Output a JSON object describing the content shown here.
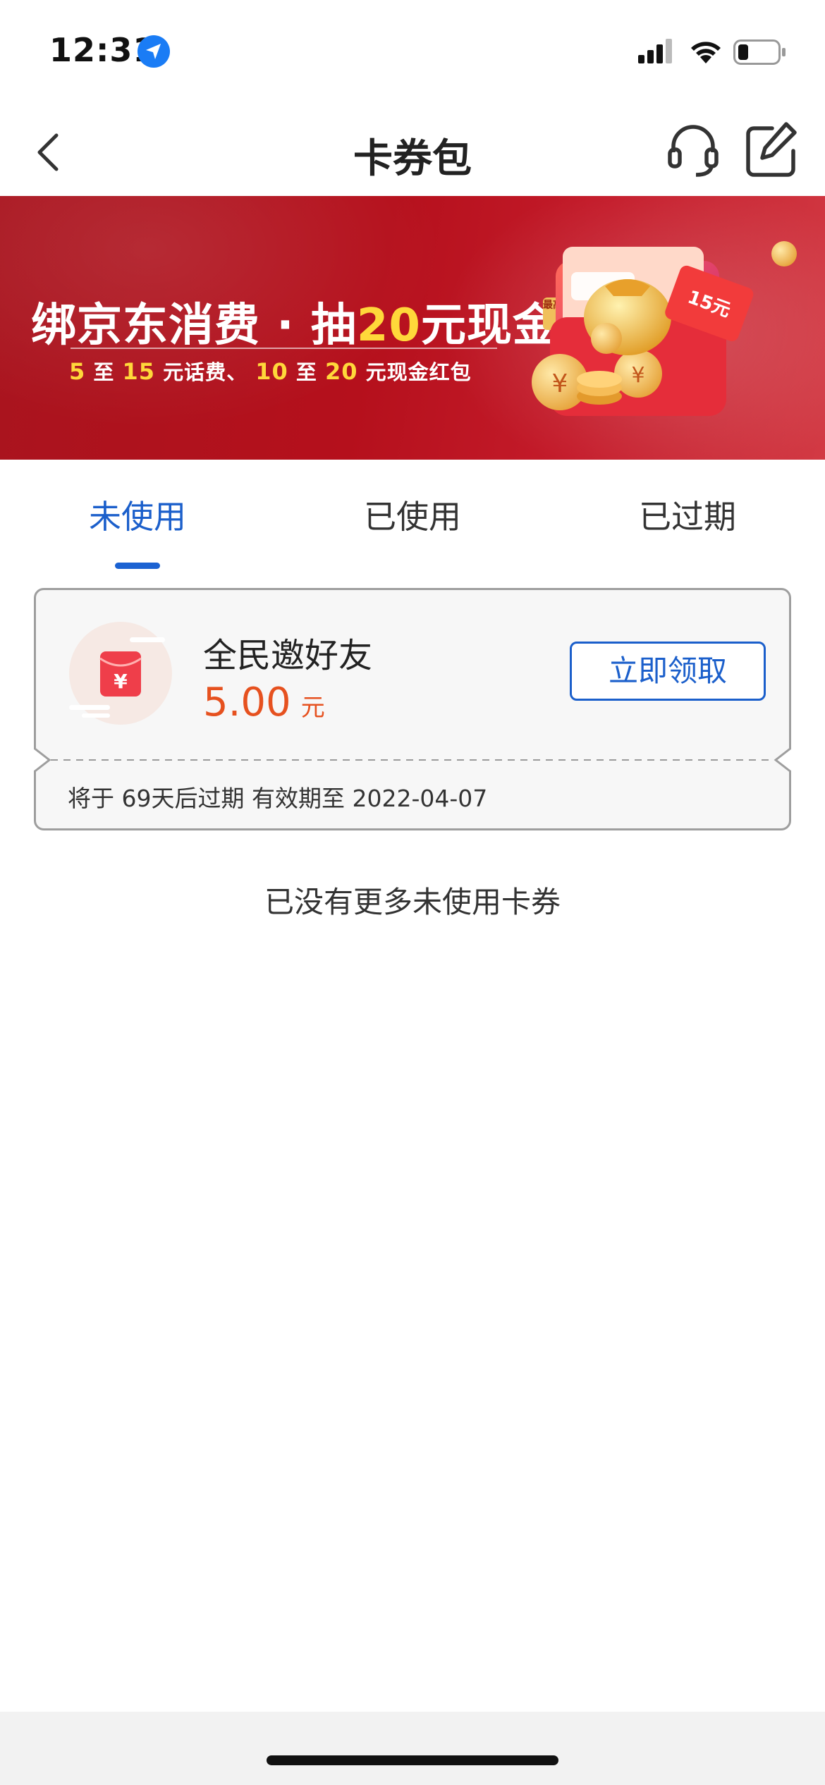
{
  "status_bar": {
    "time": "12:31"
  },
  "nav": {
    "title": "卡券包"
  },
  "banner": {
    "headline_part1": "绑京东消费 · 抽",
    "headline_highlight": "20",
    "headline_part2": "元现金",
    "tag": "最高",
    "sub": {
      "n1": "5",
      "t1": " 至 ",
      "n2": "15",
      "t2": " 元话费、  ",
      "n3": "10",
      "t3": " 至 ",
      "n4": "20",
      "t4": " 元现金红包"
    },
    "art_label": "15元"
  },
  "tabs": [
    {
      "label": "未使用",
      "active": true
    },
    {
      "label": "已使用",
      "active": false
    },
    {
      "label": "已过期",
      "active": false
    }
  ],
  "coupon": {
    "name": "全民邀好友",
    "amount": "5.00",
    "unit": "元",
    "button": "立即领取",
    "expiry": "将于 69天后过期 有效期至 2022-04-07"
  },
  "list_end": "已没有更多未使用卡券",
  "colors": {
    "accent_blue": "#1b5fcb",
    "amount_orange": "#e6511f",
    "banner_red": "#b5101c",
    "banner_yellow": "#ffd83a"
  }
}
